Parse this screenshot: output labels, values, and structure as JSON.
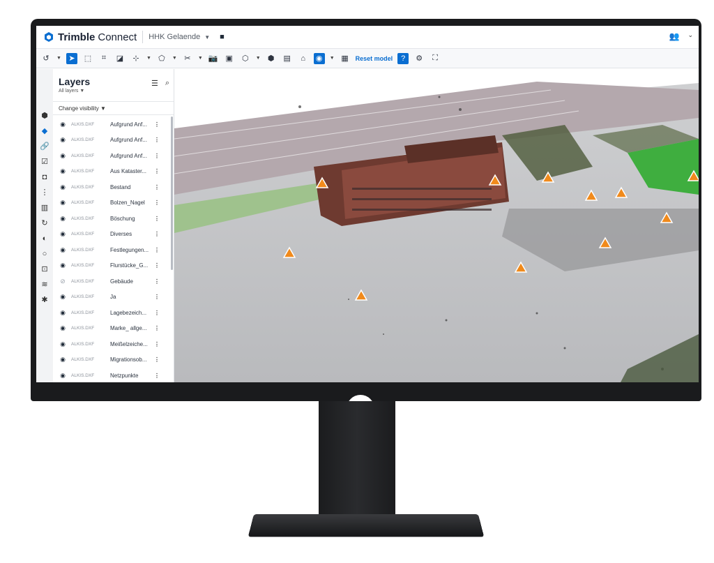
{
  "app": {
    "name_bold": "Trimble",
    "name_light": "Connect",
    "project": "HHK Gelaende"
  },
  "toolbar": {
    "reset_label": "Reset model"
  },
  "panel": {
    "title": "Layers",
    "subtitle": "All layers",
    "change_visibility": "Change visibility",
    "rows": [
      {
        "source": "ALKIS.DXF",
        "name": "Aufgrund Anf...",
        "visible": true
      },
      {
        "source": "ALKIS.DXF",
        "name": "Aufgrund Anf...",
        "visible": true
      },
      {
        "source": "ALKIS.DXF",
        "name": "Aufgrund Anf...",
        "visible": true
      },
      {
        "source": "ALKIS.DXF",
        "name": "Aus Kataster...",
        "visible": true
      },
      {
        "source": "ALKIS.DXF",
        "name": "Bestand",
        "visible": true
      },
      {
        "source": "ALKIS.DXF",
        "name": "Bolzen_Nagel",
        "visible": true
      },
      {
        "source": "ALKIS.DXF",
        "name": "Böschung",
        "visible": true
      },
      {
        "source": "ALKIS.DXF",
        "name": "Diverses",
        "visible": true
      },
      {
        "source": "ALKIS.DXF",
        "name": "Festlegungen...",
        "visible": true
      },
      {
        "source": "ALKIS.DXF",
        "name": "Flurstücke_G...",
        "visible": true
      },
      {
        "source": "ALKIS.DXF",
        "name": "Gebäude",
        "visible": false
      },
      {
        "source": "ALKIS.DXF",
        "name": "Ja",
        "visible": true
      },
      {
        "source": "ALKIS.DXF",
        "name": "Lagebezeich...",
        "visible": true
      },
      {
        "source": "ALKIS.DXF",
        "name": "Marke_ allge...",
        "visible": true
      },
      {
        "source": "ALKIS.DXF",
        "name": "Meißelzeiche...",
        "visible": true
      },
      {
        "source": "ALKIS.DXF",
        "name": "Migrationsob...",
        "visible": true
      },
      {
        "source": "ALKIS.DXF",
        "name": "Netzpunkte",
        "visible": true
      }
    ]
  },
  "icons": {
    "visible": "eye-icon",
    "hidden": "eye-off-icon",
    "marker": "warning-triangle-icon"
  },
  "colors": {
    "accent": "#0a6ed1",
    "marker": "#f08a1c"
  }
}
